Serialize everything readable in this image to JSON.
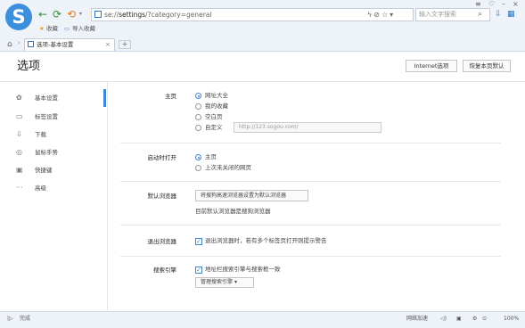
{
  "browser": {
    "address_prefix": "se://",
    "address_main": "settings",
    "address_suffix": "/?category=general",
    "search_placeholder": "输入文字搜索",
    "bookmarks": [
      "收藏",
      "导入收藏"
    ],
    "tab_title": "选项-基本设置",
    "status_left": "完成",
    "status_right": [
      "网络加速",
      "100%"
    ]
  },
  "page": {
    "title": "选项",
    "btn_ie": "Internet选项",
    "btn_restore": "恢复本页默认"
  },
  "sidebar": {
    "items": [
      {
        "label": "基本设置",
        "icon": "gear-icon",
        "glyph": "✿"
      },
      {
        "label": "标签设置",
        "icon": "tab-icon",
        "glyph": "▭"
      },
      {
        "label": "下载",
        "icon": "download-icon",
        "glyph": "⇩"
      },
      {
        "label": "鼠标手势",
        "icon": "mouse-icon",
        "glyph": "◎"
      },
      {
        "label": "快捷键",
        "icon": "keyboard-icon",
        "glyph": "▣"
      },
      {
        "label": "高级",
        "icon": "more-icon",
        "glyph": "···"
      }
    ]
  },
  "sections": {
    "homepage": {
      "label": "主页",
      "options": [
        "网址大全",
        "我的收藏",
        "空白页",
        "自定义"
      ],
      "selected": 0,
      "custom_placeholder": "http://123.sogou.com/"
    },
    "startup": {
      "label": "启动时打开",
      "options": [
        "主页",
        "上次未关闭的网页"
      ],
      "selected": 0
    },
    "default_browser": {
      "label": "默认浏览器",
      "button": "将搜狗高速浏览器设置为默认浏览器",
      "note": "目前默认浏览器是搜狗浏览器"
    },
    "close_browser": {
      "label": "退出浏览器",
      "checkbox": "退出浏览器时，若有多个标签页打开则提示警告",
      "checked": true
    },
    "search_engine": {
      "label": "搜索引擎",
      "checkbox": "地址栏搜索引擎与搜索框一致",
      "checked": true,
      "dropdown": "管理搜索引擎"
    }
  },
  "colors": {
    "accent": "#3c86d6",
    "logo": "#3d8fdc"
  }
}
